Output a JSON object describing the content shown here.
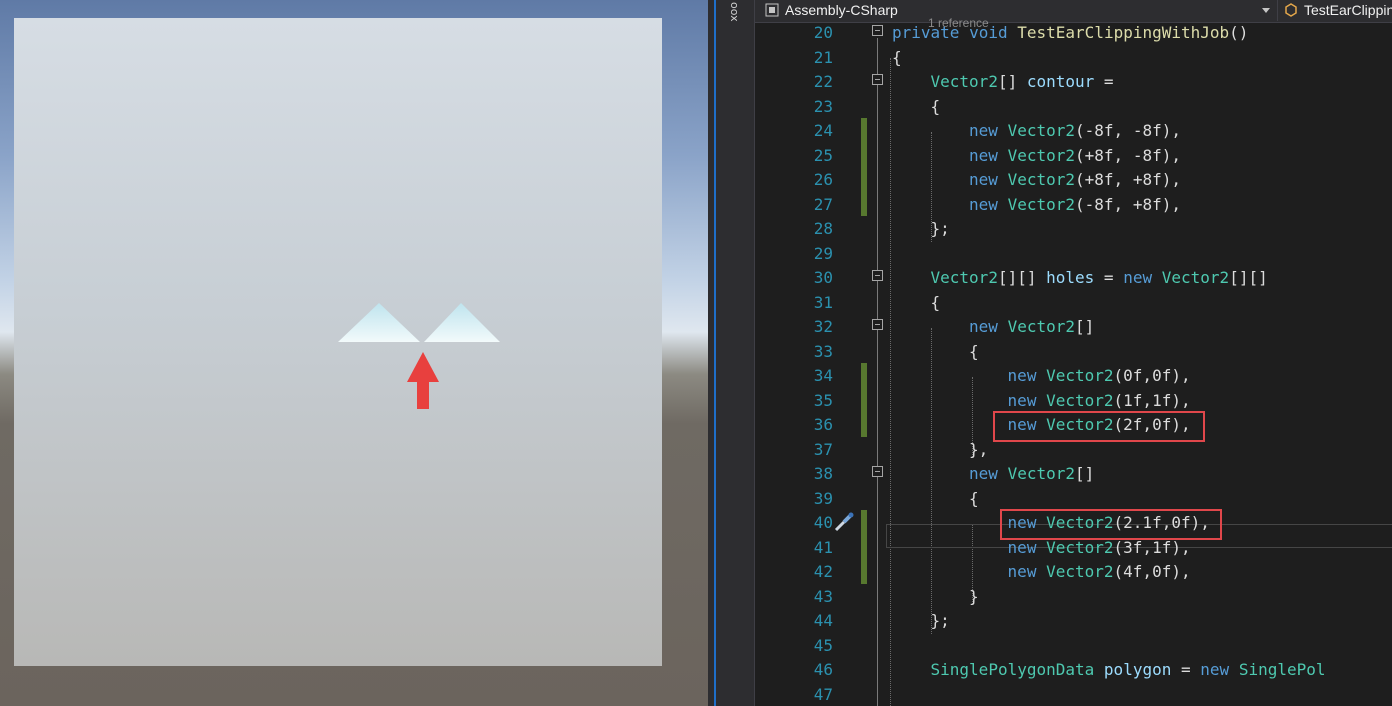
{
  "scene": {
    "colors": {
      "sky": "#8aa3c8",
      "ground": "#6b645d",
      "quad": "#c7ced4",
      "mesh": "#e8f4f6",
      "arrow": "#e8403e"
    },
    "icons": [
      "up-arrow-annotation"
    ]
  },
  "toolbox": {
    "label": "oox"
  },
  "navbar": {
    "project": "Assembly-CSharp",
    "class": "TestEarClippin",
    "icons": [
      "csharp-project-icon",
      "dropdown-arrow-icon",
      "class-icon"
    ]
  },
  "editor": {
    "reference_hint": "1 reference",
    "lines": [
      {
        "n": "20"
      },
      {
        "n": "21"
      },
      {
        "n": "22"
      },
      {
        "n": "23"
      },
      {
        "n": "24"
      },
      {
        "n": "25"
      },
      {
        "n": "26"
      },
      {
        "n": "27"
      },
      {
        "n": "28"
      },
      {
        "n": "29"
      },
      {
        "n": "30"
      },
      {
        "n": "31"
      },
      {
        "n": "32"
      },
      {
        "n": "33"
      },
      {
        "n": "34"
      },
      {
        "n": "35"
      },
      {
        "n": "36"
      },
      {
        "n": "37"
      },
      {
        "n": "38"
      },
      {
        "n": "39"
      },
      {
        "n": "40"
      },
      {
        "n": "41"
      },
      {
        "n": "42"
      },
      {
        "n": "43"
      },
      {
        "n": "44"
      },
      {
        "n": "45"
      },
      {
        "n": "46"
      },
      {
        "n": "47"
      }
    ],
    "code": {
      "l20": {
        "t1": "private",
        "t2": "void",
        "t3": "TestEarClippingWithJob",
        "t4": "()"
      },
      "l21": "{",
      "l22": {
        "t1": "Vector2",
        "t2": "[] ",
        "t3": "contour",
        "t4": " ="
      },
      "l23": "{",
      "l24": {
        "kw": "new",
        "ty": "Vector2",
        "rest": "(-8f, -8f),"
      },
      "l25": {
        "kw": "new",
        "ty": "Vector2",
        "rest": "(+8f, -8f),"
      },
      "l26": {
        "kw": "new",
        "ty": "Vector2",
        "rest": "(+8f, +8f),"
      },
      "l27": {
        "kw": "new",
        "ty": "Vector2",
        "rest": "(-8f, +8f),"
      },
      "l28": "};",
      "l30": {
        "t1": "Vector2",
        "t2": "[][] ",
        "t3": "holes",
        "t4": " = ",
        "t5": "new",
        "t6": "Vector2",
        "t7": "[][]"
      },
      "l31": "{",
      "l32": {
        "kw": "new",
        "ty": "Vector2",
        "rest": "[]"
      },
      "l33": "{",
      "l34": {
        "kw": "new",
        "ty": "Vector2",
        "rest": "(0f,0f),"
      },
      "l35": {
        "kw": "new",
        "ty": "Vector2",
        "rest": "(1f,1f),"
      },
      "l36": {
        "kw": "new",
        "ty": "Vector2",
        "rest": "(2f,0f),"
      },
      "l37": "},",
      "l38": {
        "kw": "new",
        "ty": "Vector2",
        "rest": "[]"
      },
      "l39": "{",
      "l40": {
        "kw": "new",
        "ty": "Vector2",
        "rest": "(2.1f,0f),"
      },
      "l41": {
        "kw": "new",
        "ty": "Vector2",
        "rest": "(3f,1f),"
      },
      "l42": {
        "kw": "new",
        "ty": "Vector2",
        "rest": "(4f,0f),"
      },
      "l43": "}",
      "l44": "};",
      "l46": {
        "t1": "SinglePolygonData",
        "t2": " ",
        "t3": "polygon",
        "t4": " = ",
        "t5": "new",
        "t6": "SinglePol"
      }
    },
    "colors": {
      "keyword": "#569cd6",
      "type": "#4ec9b0",
      "method": "#dcdcaa",
      "identifier": "#9cdcfe",
      "line_number": "#2b91af",
      "changed": "#57782f",
      "highlight": "#e0474b"
    },
    "icons": [
      "collapse-icon",
      "screwdriver-icon"
    ]
  }
}
